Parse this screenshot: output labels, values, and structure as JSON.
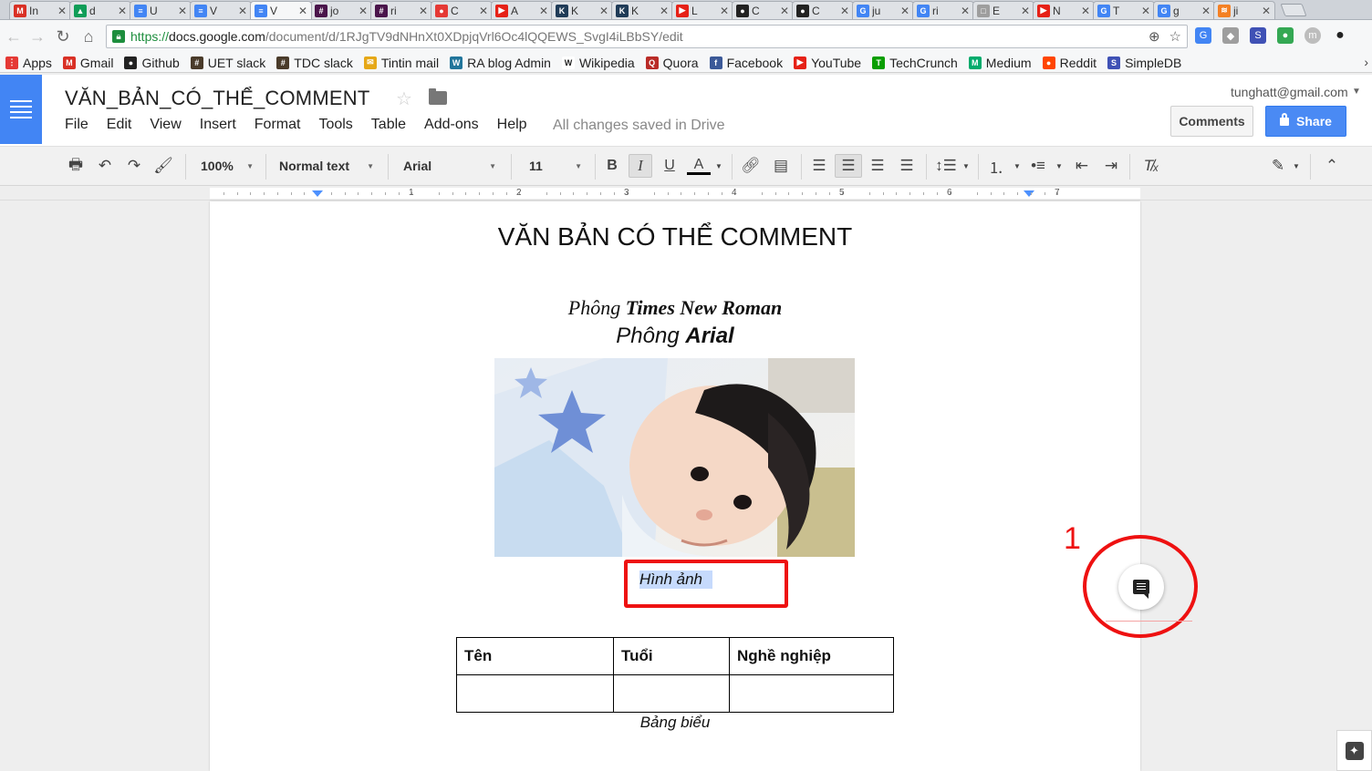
{
  "tabs": [
    {
      "title": "In",
      "favicon": "gmail-icon",
      "color": "#d93025",
      "glyph": "M"
    },
    {
      "title": "d",
      "favicon": "drive-icon",
      "color": "#0f9d58",
      "glyph": "▲"
    },
    {
      "title": "U",
      "favicon": "docs-icon",
      "color": "#4285f4",
      "glyph": "≡"
    },
    {
      "title": "V",
      "favicon": "docs-icon",
      "color": "#4285f4",
      "glyph": "≡"
    },
    {
      "title": "V",
      "favicon": "docs-icon",
      "color": "#4285f4",
      "glyph": "≡",
      "active": true
    },
    {
      "title": "jo",
      "favicon": "slack-icon",
      "color": "#4a154b",
      "glyph": "#"
    },
    {
      "title": "ri",
      "favicon": "slack-icon",
      "color": "#4a154b",
      "glyph": "#"
    },
    {
      "title": "C",
      "favicon": "pokeball-icon",
      "color": "#e53935",
      "glyph": "●"
    },
    {
      "title": "A",
      "favicon": "youtube-icon",
      "color": "#e62117",
      "glyph": "▶"
    },
    {
      "title": "K",
      "favicon": "k-icon",
      "color": "#1f3b57",
      "glyph": "K"
    },
    {
      "title": "K",
      "favicon": "k-icon",
      "color": "#1f3b57",
      "glyph": "K"
    },
    {
      "title": "L",
      "favicon": "youtube-icon",
      "color": "#e62117",
      "glyph": "▶"
    },
    {
      "title": "C",
      "favicon": "github-icon",
      "color": "#222222",
      "glyph": "●"
    },
    {
      "title": "C",
      "favicon": "github-icon",
      "color": "#222222",
      "glyph": "●"
    },
    {
      "title": "ju",
      "favicon": "google-icon",
      "color": "#4285f4",
      "glyph": "G"
    },
    {
      "title": "ri",
      "favicon": "google-icon",
      "color": "#4285f4",
      "glyph": "G"
    },
    {
      "title": "E",
      "favicon": "page-icon",
      "color": "#9e9e9e",
      "glyph": "□"
    },
    {
      "title": "N",
      "favicon": "youtube-icon",
      "color": "#e62117",
      "glyph": "▶"
    },
    {
      "title": "T",
      "favicon": "google-icon",
      "color": "#4285f4",
      "glyph": "G"
    },
    {
      "title": "g",
      "favicon": "google-icon",
      "color": "#4285f4",
      "glyph": "G"
    },
    {
      "title": "ji",
      "favicon": "stackoverflow-icon",
      "color": "#f48024",
      "glyph": "≋"
    }
  ],
  "address": {
    "https": "https://",
    "host": "docs.google.com",
    "path": "/document/d/1RJgTV9dNHnXt0XDpjqVrl6Oc4lQQEWS_SvgI4iLBbSY/edit"
  },
  "bookmarks": [
    {
      "label": "Apps",
      "icon": "apps-grid-icon",
      "color": "#e53935",
      "glyph": "⋮"
    },
    {
      "label": "Gmail",
      "icon": "gmail-icon",
      "color": "#d93025",
      "glyph": "M"
    },
    {
      "label": "Github",
      "icon": "github-icon",
      "color": "#222222",
      "glyph": "●"
    },
    {
      "label": "UET slack",
      "icon": "slack-icon",
      "color": "#4a3b2a",
      "glyph": "#"
    },
    {
      "label": "TDC slack",
      "icon": "slack-icon",
      "color": "#4a3b2a",
      "glyph": "#"
    },
    {
      "label": "Tintin mail",
      "icon": "mail-icon",
      "color": "#e6a817",
      "glyph": "✉"
    },
    {
      "label": "RA blog Admin",
      "icon": "wordpress-icon",
      "color": "#21759b",
      "glyph": "W"
    },
    {
      "label": "Wikipedia",
      "icon": "wikipedia-icon",
      "color": "#ffffff",
      "glyph": "W"
    },
    {
      "label": "Quora",
      "icon": "quora-icon",
      "color": "#b92b27",
      "glyph": "Q"
    },
    {
      "label": "Facebook",
      "icon": "facebook-icon",
      "color": "#3b5998",
      "glyph": "f"
    },
    {
      "label": "YouTube",
      "icon": "youtube-icon",
      "color": "#e62117",
      "glyph": "▶"
    },
    {
      "label": "TechCrunch",
      "icon": "techcrunch-icon",
      "color": "#0a9e01",
      "glyph": "T"
    },
    {
      "label": "Medium",
      "icon": "medium-icon",
      "color": "#00ab6c",
      "glyph": "M"
    },
    {
      "label": "Reddit",
      "icon": "reddit-icon",
      "color": "#ff4500",
      "glyph": "●"
    },
    {
      "label": "SimpleDB",
      "icon": "simpledb-icon",
      "color": "#3f51b5",
      "glyph": "S"
    }
  ],
  "doc": {
    "title": "VĂN_BẢN_CÓ_THỂ_COMMENT",
    "menus": [
      "File",
      "Edit",
      "View",
      "Insert",
      "Format",
      "Tools",
      "Table",
      "Add-ons",
      "Help"
    ],
    "save_status": "All changes saved in Drive",
    "account": "tunghatt@gmail.com",
    "comments_label": "Comments",
    "share_label": "Share"
  },
  "toolbar": {
    "zoom": "100%",
    "style": "Normal text",
    "font": "Arial",
    "size": "11"
  },
  "ruler": {
    "numbers": [
      "1",
      "2",
      "3",
      "4",
      "5",
      "6",
      "7"
    ]
  },
  "content": {
    "heading": "VĂN BẢN CÓ THỂ COMMENT",
    "line1_prefix": "Phông ",
    "line1_bold": "Times New Roman",
    "line2_prefix": "Phông ",
    "line2_bold": "Arial",
    "image_caption": "Hình ảnh",
    "table_headers": [
      "Tên",
      "Tuổi",
      "Nghề nghiệp"
    ],
    "table_caption": "Bảng biểu"
  },
  "annotation": {
    "number": "1",
    "color": "#ee1111"
  }
}
